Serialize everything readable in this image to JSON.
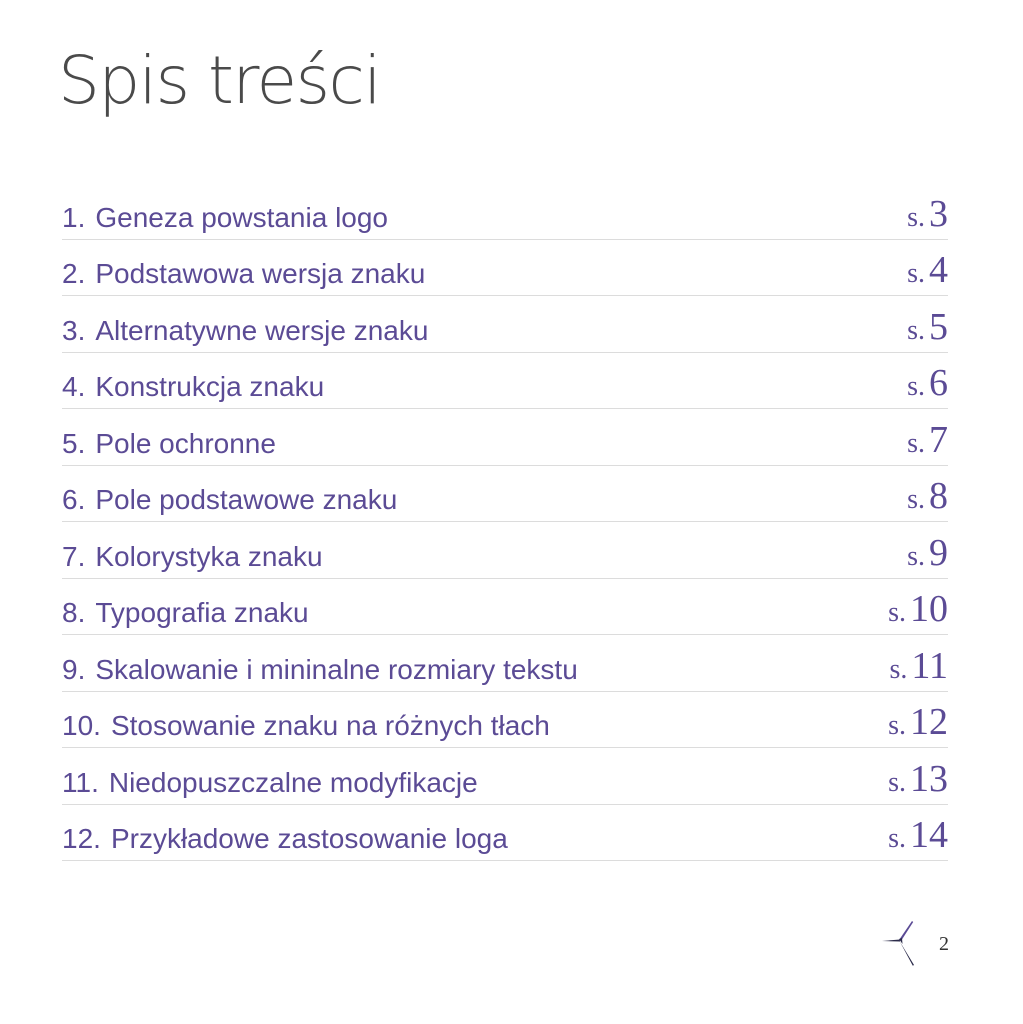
{
  "page": {
    "title": "Spis treści",
    "page_number": "2",
    "colors": {
      "accent": "#5b4b95",
      "title": "#4a4a4a",
      "divider": "#dcdcdc"
    }
  },
  "toc": {
    "page_prefix": "s.",
    "items": [
      {
        "num": "1.",
        "label": "Geneza powstania logo",
        "page": "3"
      },
      {
        "num": "2.",
        "label": "Podstawowa wersja znaku",
        "page": "4"
      },
      {
        "num": "3.",
        "label": "Alternatywne wersje znaku",
        "page": "5"
      },
      {
        "num": "4.",
        "label": "Konstrukcja znaku",
        "page": "6"
      },
      {
        "num": "5.",
        "label": "Pole ochronne",
        "page": "7"
      },
      {
        "num": "6.",
        "label": "Pole podstawowe znaku",
        "page": "8"
      },
      {
        "num": "7.",
        "label": "Kolorystyka znaku",
        "page": "9"
      },
      {
        "num": "8.",
        "label": "Typografia znaku",
        "page": "10"
      },
      {
        "num": "9.",
        "label": "Skalowanie i mininalne rozmiary tekstu",
        "page": "11"
      },
      {
        "num": "10.",
        "label": "Stosowanie znaku na różnych tłach",
        "page": "12"
      },
      {
        "num": "11.",
        "label": "Niedopuszczalne modyfikacje",
        "page": "13"
      },
      {
        "num": "12.",
        "label": "Przykładowe zastosowanie loga",
        "page": "14"
      }
    ]
  },
  "footer": {
    "logo_icon": "star-logo-icon"
  }
}
